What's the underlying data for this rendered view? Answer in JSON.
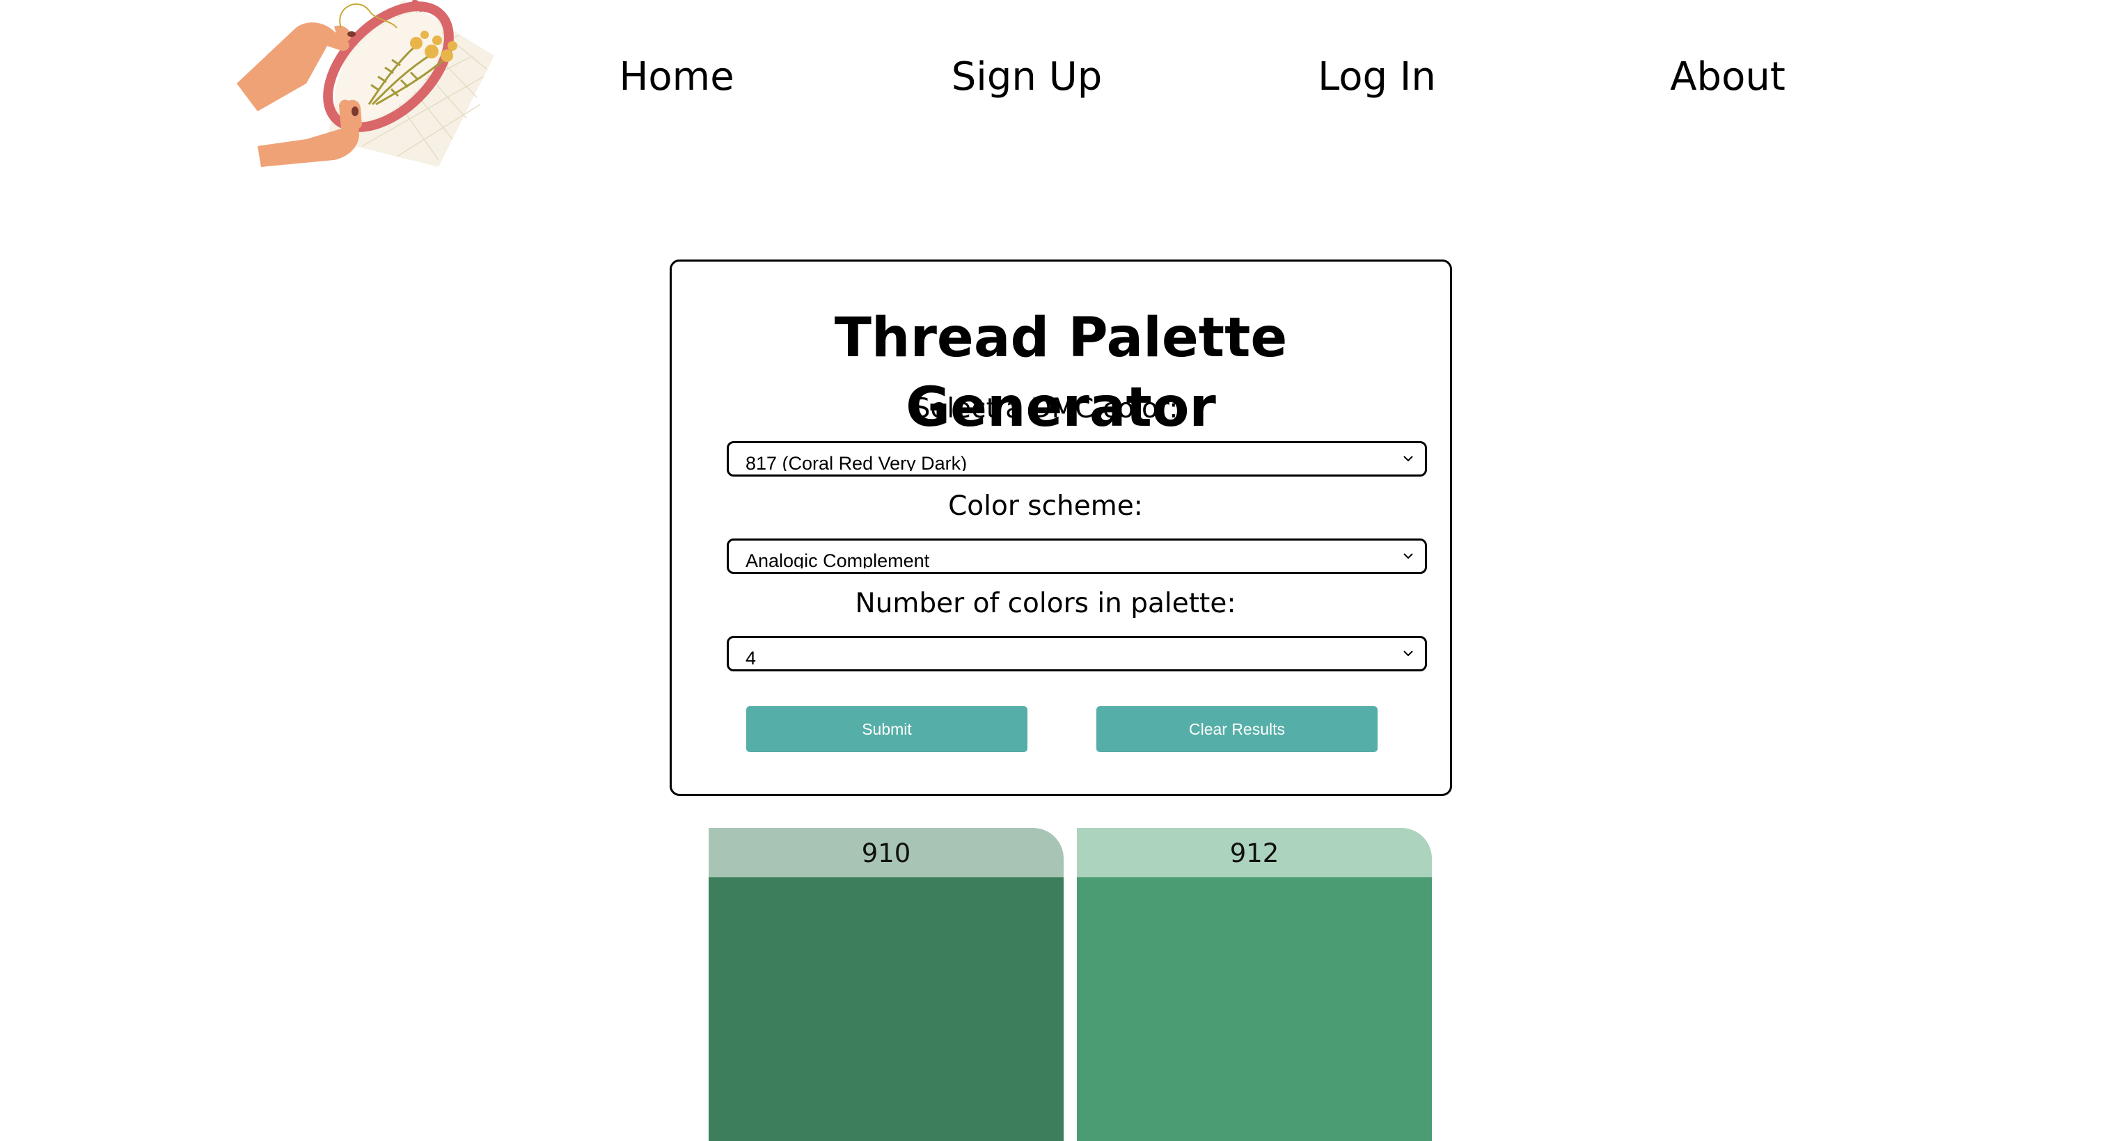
{
  "nav": {
    "items": [
      {
        "label": "Home"
      },
      {
        "label": "Sign Up"
      },
      {
        "label": "Log In"
      },
      {
        "label": "About"
      }
    ]
  },
  "form": {
    "title": "Thread Palette Generator",
    "dmc_label": "Select a DMC color:",
    "dmc_value": "817 (Coral Red Very Dark)",
    "scheme_label": "Color scheme:",
    "scheme_value": "Analogic Complement",
    "count_label": "Number of colors in palette:",
    "count_value": "4",
    "submit_label": "Submit",
    "clear_label": "Clear Results"
  },
  "palette": {
    "swatches": [
      {
        "code": "910",
        "header_color": "#a7c4b5",
        "color": "#3d7f5c"
      },
      {
        "code": "912",
        "header_color": "#acd3bd",
        "color": "#4b9c72"
      }
    ]
  },
  "colors": {
    "accent": "#55aea7",
    "card_border": "#000000"
  },
  "icons": {
    "logo": "embroidery-hoop-hands-logo",
    "select_arrow": "chevron-down-icon"
  }
}
